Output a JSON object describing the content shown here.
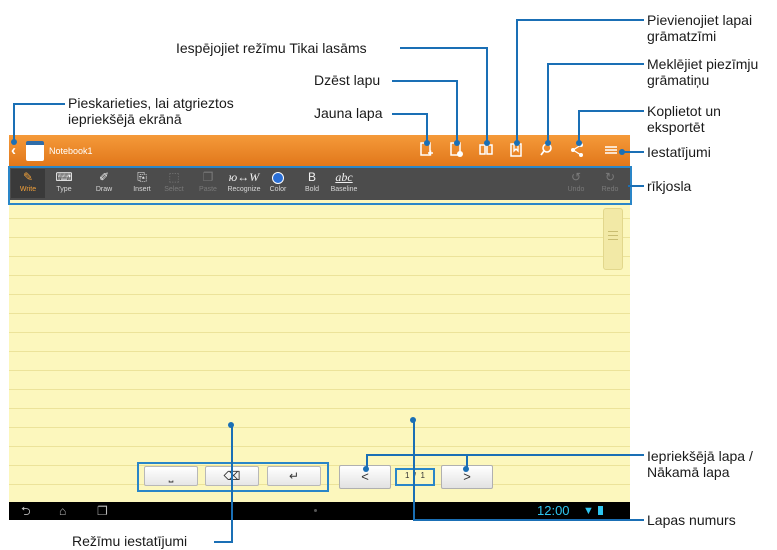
{
  "app": {
    "notebook_title": "Notebook1",
    "page_indicator": "1  /  1",
    "clock": "12:00"
  },
  "toolbar": {
    "items": [
      {
        "label": "Write",
        "icon": "pen-icon"
      },
      {
        "label": "Type",
        "icon": "keyboard-icon"
      },
      {
        "label": "Draw",
        "icon": "brush-icon"
      },
      {
        "label": "Insert",
        "icon": "insert-icon"
      },
      {
        "label": "Select",
        "icon": "select-icon"
      },
      {
        "label": "Paste",
        "icon": "paste-icon"
      },
      {
        "label": "Recognize",
        "icon": "recognize-icon",
        "glyph": "ю↔W"
      },
      {
        "label": "Color",
        "icon": "color-dot-icon"
      },
      {
        "label": "Bold",
        "icon": "bold-icon",
        "glyph": "B"
      },
      {
        "label": "Baseline",
        "icon": "baseline-icon",
        "glyph": "abc"
      },
      {
        "label": "Undo",
        "icon": "undo-icon"
      },
      {
        "label": "Redo",
        "icon": "redo-icon"
      }
    ]
  },
  "callouts": {
    "back": "Pieskarieties, lai atgrieztos\niepriekšējā ekrānā",
    "readonly": "Iespējojiet režīmu Tikai lasāms",
    "delete": "Dzēst lapu",
    "new_page": "Jauna lapa",
    "bookmark": "Pievienojiet lapai\ngrāmatzīmi",
    "search": "Meklējiet piezīmju\ngrāmatiņu",
    "share": "Koplietot un\neksportēt",
    "settings": "Iestatījumi",
    "toolbar": "rīkjosla",
    "prev_next": "Iepriekšējā lapa /\nNākamā lapa",
    "page_number": "Lapas numurs",
    "mode_settings": "Režīmu iestatījumi"
  },
  "colors": {
    "accent_orange": "#e8841f",
    "callout_line": "#1a6fb5",
    "paper": "#fcf7bd",
    "clock": "#2ec5f0"
  }
}
